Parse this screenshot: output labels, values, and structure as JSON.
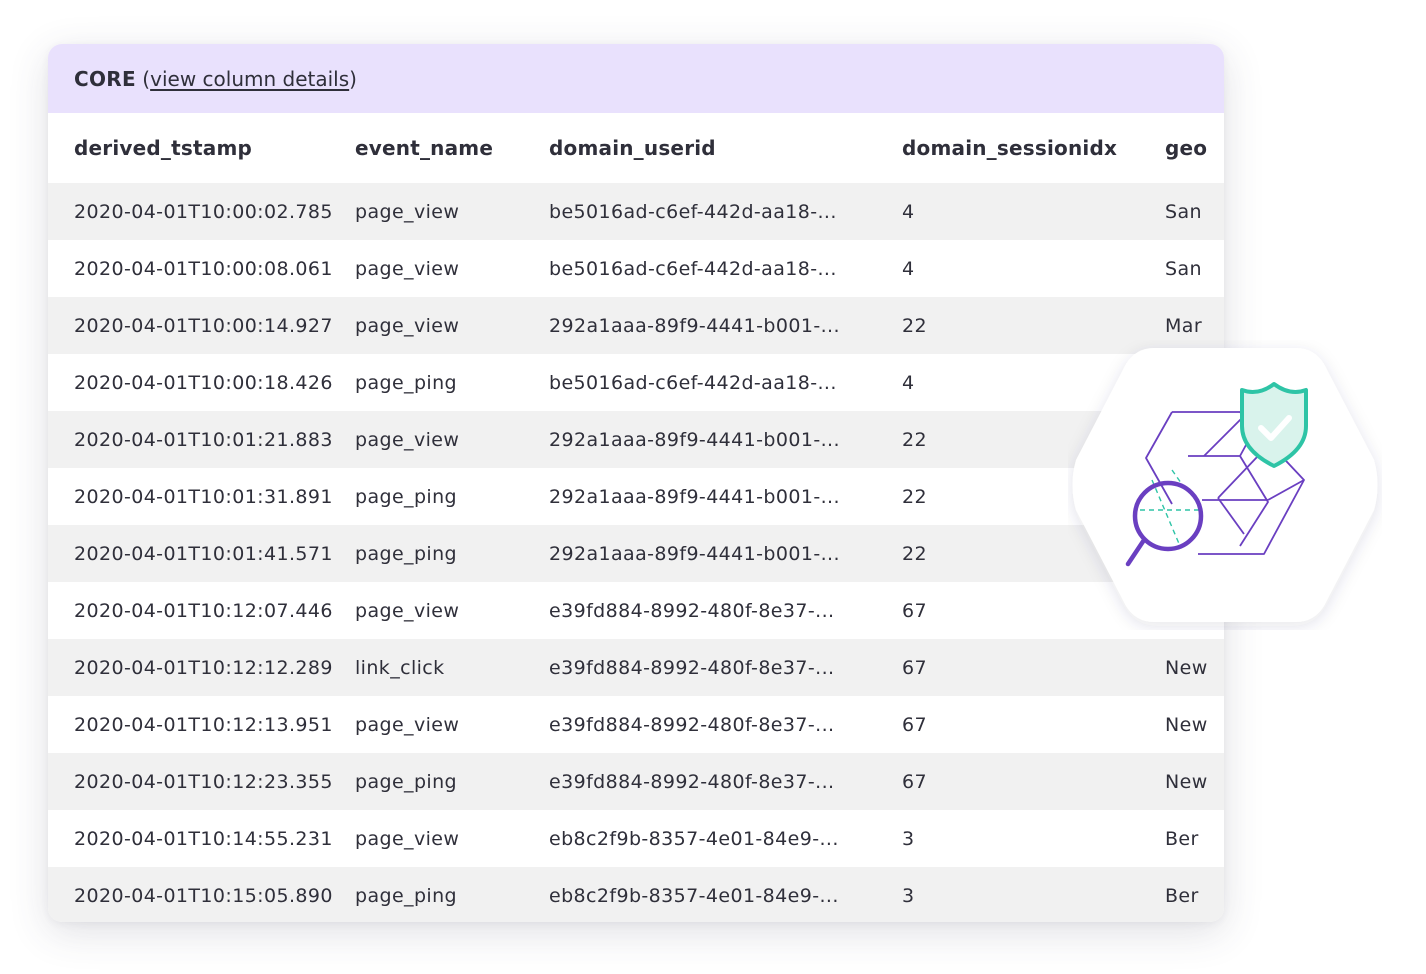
{
  "header": {
    "section": "CORE",
    "open_paren": " (",
    "link_label": "view column details",
    "close_paren": ")"
  },
  "table": {
    "columns": [
      "derived_tstamp",
      "event_name",
      "domain_userid",
      "domain_sessionidx",
      "geo"
    ],
    "rows": [
      [
        "2020-04-01T10:00:02.785",
        "page_view",
        "be5016ad-c6ef-442d-aa18-...",
        "4",
        "San"
      ],
      [
        "2020-04-01T10:00:08.061",
        "page_view",
        "be5016ad-c6ef-442d-aa18-...",
        "4",
        "San"
      ],
      [
        "2020-04-01T10:00:14.927",
        "page_view",
        "292a1aaa-89f9-4441-b001-...",
        "22",
        "Mar"
      ],
      [
        "2020-04-01T10:00:18.426",
        "page_ping",
        "be5016ad-c6ef-442d-aa18-...",
        "4",
        ""
      ],
      [
        "2020-04-01T10:01:21.883",
        "page_view",
        "292a1aaa-89f9-4441-b001-...",
        "22",
        ""
      ],
      [
        "2020-04-01T10:01:31.891",
        "page_ping",
        "292a1aaa-89f9-4441-b001-...",
        "22",
        ""
      ],
      [
        "2020-04-01T10:01:41.571",
        "page_ping",
        "292a1aaa-89f9-4441-b001-...",
        "22",
        ""
      ],
      [
        "2020-04-01T10:12:07.446",
        "page_view",
        "e39fd884-8992-480f-8e37-...",
        "67",
        ""
      ],
      [
        "2020-04-01T10:12:12.289",
        "link_click",
        "e39fd884-8992-480f-8e37-...",
        "67",
        "New"
      ],
      [
        "2020-04-01T10:12:13.951",
        "page_view",
        "e39fd884-8992-480f-8e37-...",
        "67",
        "New"
      ],
      [
        "2020-04-01T10:12:23.355",
        "page_ping",
        "e39fd884-8992-480f-8e37-...",
        "67",
        "New"
      ],
      [
        "2020-04-01T10:14:55.231",
        "page_view",
        "eb8c2f9b-8357-4e01-84e9-...",
        "3",
        "Ber"
      ],
      [
        "2020-04-01T10:15:05.890",
        "page_ping",
        "eb8c2f9b-8357-4e01-84e9-...",
        "3",
        "Ber"
      ]
    ]
  },
  "badge": {
    "icon": "data-quality-shield-magnifier-icon",
    "colors": {
      "purple": "#6a3fc1",
      "teal": "#2ec4a6",
      "teal_fill": "#d9f3ec"
    }
  },
  "colors": {
    "header_bg": "#e9e1fd",
    "row_alt_bg": "#f1f1f1",
    "text": "#2f2f3a"
  }
}
